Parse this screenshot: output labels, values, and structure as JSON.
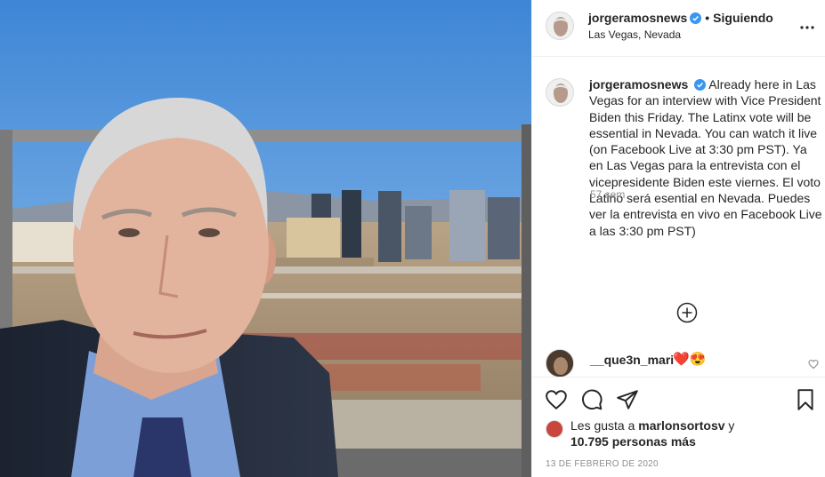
{
  "header": {
    "username": "jorgeramosnews",
    "separator": "•",
    "follow_status": "Siguiendo",
    "location": "Las Vegas, Nevada",
    "more_icon": "more-horizontal-icon"
  },
  "caption": {
    "username": "jorgeramosnews",
    "text": "Already here in Las Vegas for an interview with Vice President Biden this Friday. The Latinx vote will be essential in Nevada. You can watch it live (on Facebook Live at 3:30 pm PST). Ya en Las Vegas para la entrevista con el vicepresidente Biden este viernes. El voto Latino será esential en Nevada. Puedes ver la entrevista en vivo en Facebook Live a las 3:30 pm PST)",
    "time": "57 sem"
  },
  "load_more_icon": "plus-circle-icon",
  "comment": {
    "username": "__que3n_mari",
    "text": "❤️😍"
  },
  "likes": {
    "prefix": "Les gusta a",
    "liker": "marlonsortosv",
    "conjunction": "y",
    "count_text": "10.795 personas más"
  },
  "date": "13 DE FEBRERO DE 2020",
  "colors": {
    "verified": "#3897f0",
    "muted": "#8e8e8e",
    "text": "#262626",
    "heart": "#ed4956"
  }
}
